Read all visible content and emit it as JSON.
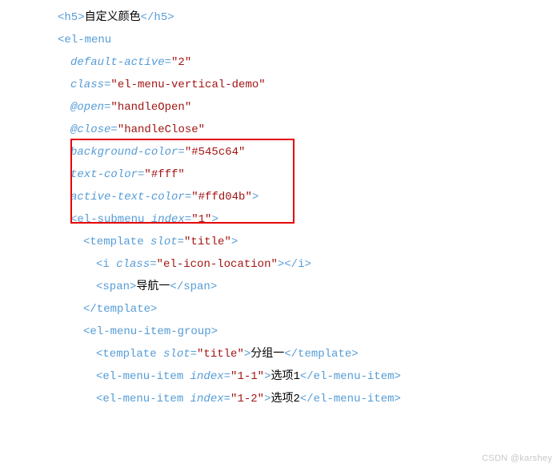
{
  "lines": [
    {
      "indent": 4,
      "parts": [
        {
          "cls": "tag",
          "text": "<h5>"
        },
        {
          "cls": "txt",
          "text": "自定义颜色"
        },
        {
          "cls": "tag",
          "text": "</h5>"
        }
      ]
    },
    {
      "indent": 4,
      "parts": [
        {
          "cls": "tag",
          "text": "<el-menu"
        }
      ]
    },
    {
      "indent": 6,
      "parts": [
        {
          "cls": "attr",
          "text": "default-active"
        },
        {
          "cls": "tag",
          "text": "="
        },
        {
          "cls": "val",
          "text": "\"2\""
        }
      ]
    },
    {
      "indent": 6,
      "parts": [
        {
          "cls": "attr",
          "text": "class"
        },
        {
          "cls": "tag",
          "text": "="
        },
        {
          "cls": "val",
          "text": "\"el-menu-vertical-demo\""
        }
      ]
    },
    {
      "indent": 6,
      "parts": [
        {
          "cls": "attr",
          "text": "@open"
        },
        {
          "cls": "tag",
          "text": "="
        },
        {
          "cls": "val",
          "text": "\"handleOpen\""
        }
      ]
    },
    {
      "indent": 6,
      "parts": [
        {
          "cls": "attr",
          "text": "@close"
        },
        {
          "cls": "tag",
          "text": "="
        },
        {
          "cls": "val",
          "text": "\"handleClose\""
        }
      ]
    },
    {
      "indent": 6,
      "parts": [
        {
          "cls": "attr",
          "text": "background-color"
        },
        {
          "cls": "tag",
          "text": "="
        },
        {
          "cls": "val",
          "text": "\"#545c64\""
        }
      ]
    },
    {
      "indent": 6,
      "parts": [
        {
          "cls": "attr",
          "text": "text-color"
        },
        {
          "cls": "tag",
          "text": "="
        },
        {
          "cls": "val",
          "text": "\"#fff\""
        }
      ]
    },
    {
      "indent": 6,
      "parts": [
        {
          "cls": "attr",
          "text": "active-text-color"
        },
        {
          "cls": "tag",
          "text": "="
        },
        {
          "cls": "val",
          "text": "\"#ffd04b\""
        },
        {
          "cls": "tag",
          "text": ">"
        }
      ]
    },
    {
      "indent": 6,
      "parts": [
        {
          "cls": "tag",
          "text": "<el-submenu "
        },
        {
          "cls": "attr",
          "text": "index"
        },
        {
          "cls": "tag",
          "text": "="
        },
        {
          "cls": "val",
          "text": "\"1\""
        },
        {
          "cls": "tag",
          "text": ">"
        }
      ]
    },
    {
      "indent": 8,
      "parts": [
        {
          "cls": "tag",
          "text": "<template "
        },
        {
          "cls": "attr",
          "text": "slot"
        },
        {
          "cls": "tag",
          "text": "="
        },
        {
          "cls": "val",
          "text": "\"title\""
        },
        {
          "cls": "tag",
          "text": ">"
        }
      ]
    },
    {
      "indent": 10,
      "parts": [
        {
          "cls": "tag",
          "text": "<i "
        },
        {
          "cls": "attr",
          "text": "class"
        },
        {
          "cls": "tag",
          "text": "="
        },
        {
          "cls": "val",
          "text": "\"el-icon-location\""
        },
        {
          "cls": "tag",
          "text": "></i>"
        }
      ]
    },
    {
      "indent": 10,
      "parts": [
        {
          "cls": "tag",
          "text": "<span>"
        },
        {
          "cls": "txt",
          "text": "导航一"
        },
        {
          "cls": "tag",
          "text": "</span>"
        }
      ]
    },
    {
      "indent": 8,
      "parts": [
        {
          "cls": "tag",
          "text": "</template>"
        }
      ]
    },
    {
      "indent": 8,
      "parts": [
        {
          "cls": "tag",
          "text": "<el-menu-item-group>"
        }
      ]
    },
    {
      "indent": 10,
      "parts": [
        {
          "cls": "tag",
          "text": "<template "
        },
        {
          "cls": "attr",
          "text": "slot"
        },
        {
          "cls": "tag",
          "text": "="
        },
        {
          "cls": "val",
          "text": "\"title\""
        },
        {
          "cls": "tag",
          "text": ">"
        },
        {
          "cls": "txt",
          "text": "分组一"
        },
        {
          "cls": "tag",
          "text": "</template>"
        }
      ]
    },
    {
      "indent": 10,
      "parts": [
        {
          "cls": "tag",
          "text": "<el-menu-item "
        },
        {
          "cls": "attr",
          "text": "index"
        },
        {
          "cls": "tag",
          "text": "="
        },
        {
          "cls": "val",
          "text": "\"1-1\""
        },
        {
          "cls": "tag",
          "text": ">"
        },
        {
          "cls": "txt",
          "text": "选项1"
        },
        {
          "cls": "tag",
          "text": "</el-menu-item>"
        }
      ]
    },
    {
      "indent": 10,
      "parts": [
        {
          "cls": "tag",
          "text": "<el-menu-item "
        },
        {
          "cls": "attr",
          "text": "index"
        },
        {
          "cls": "tag",
          "text": "="
        },
        {
          "cls": "val",
          "text": "\"1-2\""
        },
        {
          "cls": "tag",
          "text": ">"
        },
        {
          "cls": "txt",
          "text": "选项2"
        },
        {
          "cls": "tag",
          "text": "</el-menu-item>"
        }
      ]
    }
  ],
  "watermark": "CSDN @karshey"
}
